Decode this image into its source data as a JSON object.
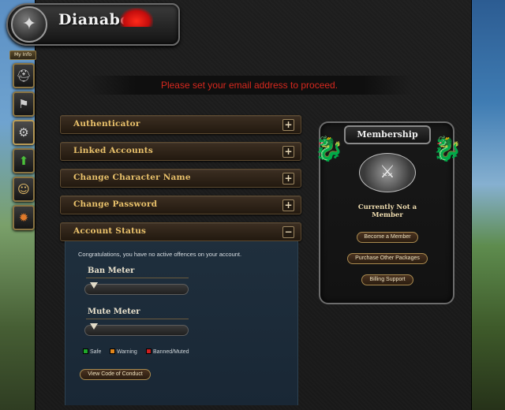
{
  "brand": {
    "name": "Dianabol",
    "emblem_icon": "guild-emblem-icon"
  },
  "nav": {
    "my_info_label": "My Info",
    "tabs": [
      {
        "icon": "helmet-icon"
      },
      {
        "icon": "banner-icon"
      },
      {
        "icon": "gear-icon"
      },
      {
        "icon": "upgrade-arrow-icon"
      },
      {
        "icon": "add-user-icon"
      },
      {
        "icon": "bomb-icon"
      }
    ]
  },
  "alert": {
    "message": "Please set your email address to proceed.",
    "color": "#d8281e"
  },
  "sections": [
    {
      "label": "Authenticator",
      "toggle": "+"
    },
    {
      "label": "Linked Accounts",
      "toggle": "+"
    },
    {
      "label": "Change Character Name",
      "toggle": "+"
    },
    {
      "label": "Change Password",
      "toggle": "+"
    },
    {
      "label": "Account Status",
      "toggle": "−"
    }
  ],
  "account_status": {
    "message": "Congratulations, you have no active offences on your account.",
    "ban_meter": {
      "title": "Ban Meter",
      "level": 0
    },
    "mute_meter": {
      "title": "Mute Meter",
      "level": 0
    },
    "legend": [
      {
        "label": "Safe",
        "color": "#1fa82b"
      },
      {
        "label": "Warning",
        "color": "#e0861b"
      },
      {
        "label": "Banned/Muted",
        "color": "#d01f1f"
      }
    ],
    "code_button": "View Code of Conduct"
  },
  "membership": {
    "title": "Membership",
    "status": "Currently Not a Member",
    "buttons": [
      {
        "label": "Become a Member"
      },
      {
        "label": "Purchase Other Packages"
      },
      {
        "label": "Billing Support"
      }
    ]
  },
  "colors": {
    "accent_gold": "#e9c16b",
    "panel_bg": "#1b1b1b",
    "status_bg": "#1e2e3c"
  }
}
